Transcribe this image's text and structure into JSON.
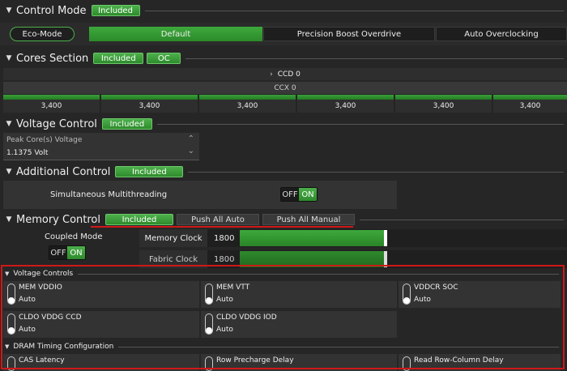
{
  "control_mode": {
    "title": "Control Mode",
    "badge": "Included",
    "eco_mode": "Eco-Mode",
    "tabs": [
      "Default",
      "Precision Boost Overdrive",
      "Auto Overclocking"
    ]
  },
  "cores": {
    "title": "Cores Section",
    "badge": "Included",
    "oc": "OC",
    "ccd": "CCD 0",
    "ccx": "CCX 0",
    "freqs": [
      "3,400",
      "3,400",
      "3,400",
      "3,400",
      "3,400",
      "3,400"
    ]
  },
  "voltage": {
    "title": "Voltage Control",
    "badge": "Included",
    "field_label": "Peak Core(s) Voltage",
    "field_value": "1.1375 Volt"
  },
  "additional": {
    "title": "Additional Control",
    "badge": "Included",
    "smt_label": "Simultaneous Multithreading",
    "toggle_off": "OFF",
    "toggle_on": "ON"
  },
  "memory": {
    "title": "Memory Control",
    "badge": "Included",
    "push_auto": "Push All Auto",
    "push_manual": "Push All Manual",
    "coupled_label": "Coupled Mode",
    "toggle_off": "OFF",
    "toggle_on": "ON",
    "mem_clock_label": "Memory Clock",
    "mem_clock_value": "1800",
    "fabric_clock_label": "Fabric Clock",
    "fabric_clock_value": "1800"
  },
  "voltage_controls": {
    "title": "Voltage Controls",
    "items": [
      {
        "name": "MEM VDDIO",
        "value": "Auto"
      },
      {
        "name": "MEM VTT",
        "value": "Auto"
      },
      {
        "name": "VDDCR SOC",
        "value": "Auto"
      },
      {
        "name": "CLDO VDDG CCD",
        "value": "Auto"
      },
      {
        "name": "CLDO VDDG IOD",
        "value": "Auto"
      }
    ]
  },
  "dram": {
    "title": "DRAM Timing Configuration",
    "items": [
      "CAS Latency",
      "Row Precharge Delay",
      "Read Row-Column Delay"
    ]
  },
  "colors": {
    "accent_green": "#3a9a38",
    "highlight_red": "#d01818"
  }
}
